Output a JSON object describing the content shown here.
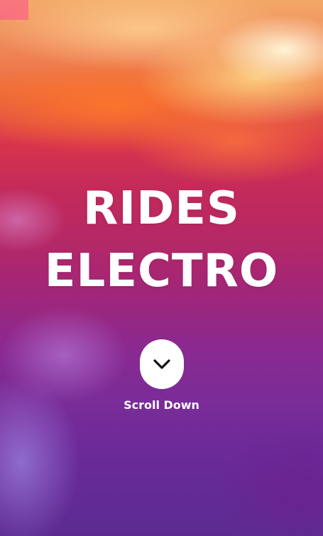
{
  "hero": {
    "title_line_1": "RIDES",
    "title_line_2": "ELECTRO",
    "scroll_label": "Scroll Down",
    "scroll_icon": "chevron-down-icon"
  },
  "colors": {
    "title_text": "#ffffff",
    "button_background": "#ffffff",
    "icon_color": "#111111",
    "sky_top": "#f2a867",
    "sky_middle": "#c42a5a",
    "sky_bottom": "#5c2b92"
  }
}
